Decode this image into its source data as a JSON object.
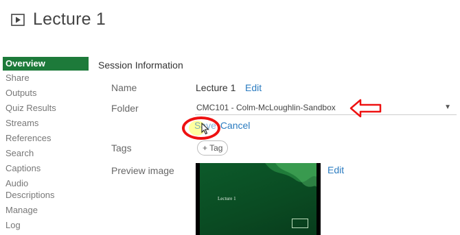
{
  "header": {
    "title": "Lecture 1",
    "icon": "play-icon"
  },
  "sidebar": {
    "items": [
      {
        "label": "Overview",
        "active": true
      },
      {
        "label": "Share"
      },
      {
        "label": "Outputs"
      },
      {
        "label": "Quiz Results"
      },
      {
        "label": "Streams"
      },
      {
        "label": "References"
      },
      {
        "label": "Search"
      },
      {
        "label": "Captions"
      },
      {
        "label": "Audio Descriptions"
      },
      {
        "label": "Manage"
      },
      {
        "label": "Log"
      }
    ]
  },
  "main": {
    "section_title": "Session Information",
    "name": {
      "label": "Name",
      "value": "Lecture 1",
      "edit": "Edit"
    },
    "folder": {
      "label": "Folder",
      "value": "CMC101 - Colm-McLoughlin-Sandbox"
    },
    "actions": {
      "save": "Save",
      "cancel": "Cancel"
    },
    "tags": {
      "label": "Tags",
      "button": "+ Tag"
    },
    "preview": {
      "label": "Preview image",
      "slide_text": "Lecture 1",
      "edit": "Edit"
    }
  },
  "colors": {
    "accent": "#1d7a3a",
    "link": "#2a7bc0",
    "highlight": "#e11111"
  }
}
